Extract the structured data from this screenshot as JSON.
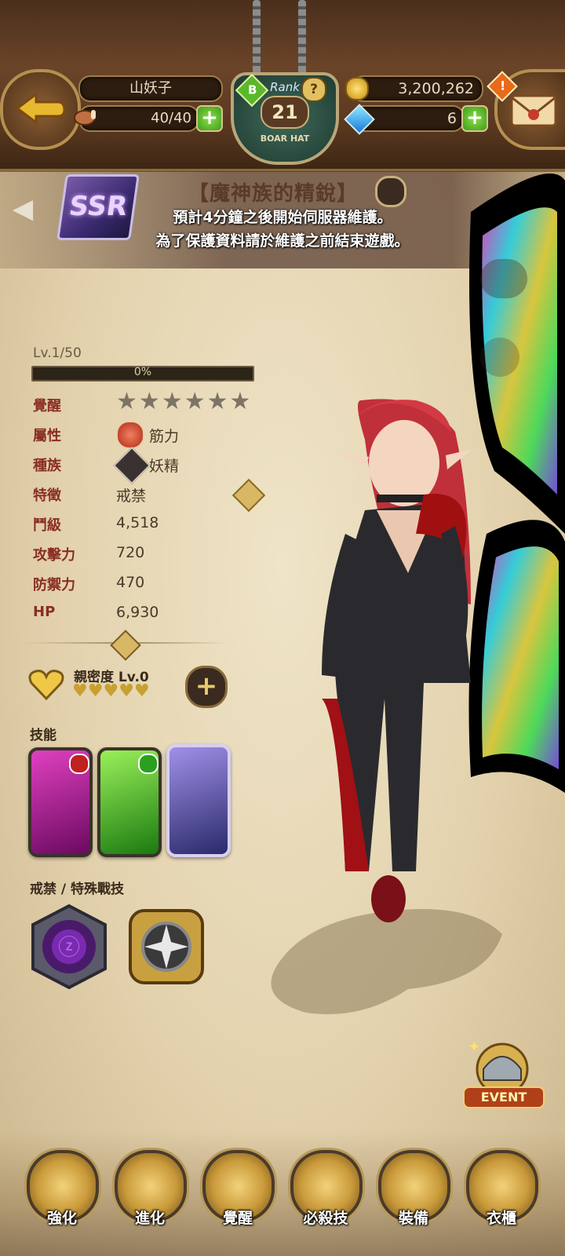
{
  "header": {
    "player_name": "山妖子",
    "stamina": "40/40",
    "rank_label": "Rank",
    "rank_level": "21",
    "rank_sub": "BOAR HAT",
    "badge_b": "B",
    "help": "?",
    "gold": "3,200,262",
    "gems": "6",
    "mail_alert": "!"
  },
  "banner": {
    "title": "【魔神族的精銳】",
    "rarity": "SSR",
    "notice_line1": "預計4分鐘之後開始伺服器維護。",
    "notice_line2": "為了保護資料請於維護之前結束遊戲。"
  },
  "stats": {
    "level": "Lv.1/50",
    "xp_text": "0%",
    "xp_progress": 0,
    "awaken_label": "覺醒",
    "awaken_stars": 6,
    "attribute_label": "屬性",
    "attribute_value": "筋力",
    "race_label": "種族",
    "race_value": "妖精",
    "trait_label": "特徵",
    "trait_value": "戒禁",
    "grade_label": "鬥級",
    "grade_value": "4,518",
    "attack_label": "攻擊力",
    "attack_value": "720",
    "defense_label": "防禦力",
    "defense_value": "470",
    "hp_label": "HP",
    "hp_value": "6,930"
  },
  "affinity": {
    "label": "親密度 Lv.0",
    "hearts": 5
  },
  "skills": {
    "title": "技能",
    "cards": [
      {
        "name": "skill-1",
        "color": "#b0208a"
      },
      {
        "name": "skill-2",
        "color": "#3ab81a"
      },
      {
        "name": "skill-3",
        "color": "#6a5ab8"
      }
    ]
  },
  "special": {
    "title": "戒禁 / 特殊戰技"
  },
  "event": {
    "label": "EVENT"
  },
  "nav": {
    "items": [
      {
        "label": "強化",
        "icon": "helmet-upgrade-icon"
      },
      {
        "label": "進化",
        "icon": "evolve-icon"
      },
      {
        "label": "覺醒",
        "icon": "awaken-orb-icon"
      },
      {
        "label": "必殺技",
        "icon": "ultimate-book-icon"
      },
      {
        "label": "裝備",
        "icon": "equipment-icon"
      },
      {
        "label": "衣櫃",
        "icon": "wardrobe-icon"
      }
    ]
  },
  "colors": {
    "accent_red": "#8a2e22",
    "gold": "#c99a3a",
    "plus_green": "#3f9a1c"
  }
}
